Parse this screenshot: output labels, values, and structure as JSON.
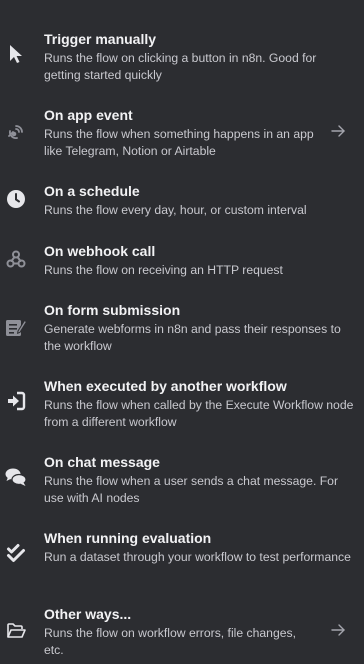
{
  "triggers": [
    {
      "title": "Trigger manually",
      "description": "Runs the flow on clicking a button in n8n. Good for getting started quickly",
      "icon": "mouse-pointer-icon"
    },
    {
      "title": "On app event",
      "description": "Runs the flow when something happens in an app like Telegram, Notion or Airtable",
      "icon": "satellite-dish-icon",
      "has_arrow": true
    },
    {
      "title": "On a schedule",
      "description": "Runs the flow every day, hour, or custom interval",
      "icon": "clock-icon"
    },
    {
      "title": "On webhook call",
      "description": "Runs the flow on receiving an HTTP request",
      "icon": "webhook-icon"
    },
    {
      "title": "On form submission",
      "description": "Generate webforms in n8n and pass their responses to the workflow",
      "icon": "form-icon"
    },
    {
      "title": "When executed by another workflow",
      "description": "Runs the flow when called by the Execute Workflow node from a different workflow",
      "icon": "sign-in-icon"
    },
    {
      "title": "On chat message",
      "description": "Runs the flow when a user sends a chat message. For use with AI nodes",
      "icon": "comments-icon"
    },
    {
      "title": "When running evaluation",
      "description": "Run a dataset through your workflow to test performance",
      "icon": "check-double-icon"
    },
    {
      "title": "Other ways...",
      "description": "Runs the flow on workflow errors, file changes, etc.",
      "icon": "folder-open-icon",
      "has_arrow": true
    }
  ],
  "colors": {
    "background": "#2c2d31",
    "title": "#f2f2f4",
    "description": "#c9c9cf",
    "icon": "#e6e6ea"
  }
}
